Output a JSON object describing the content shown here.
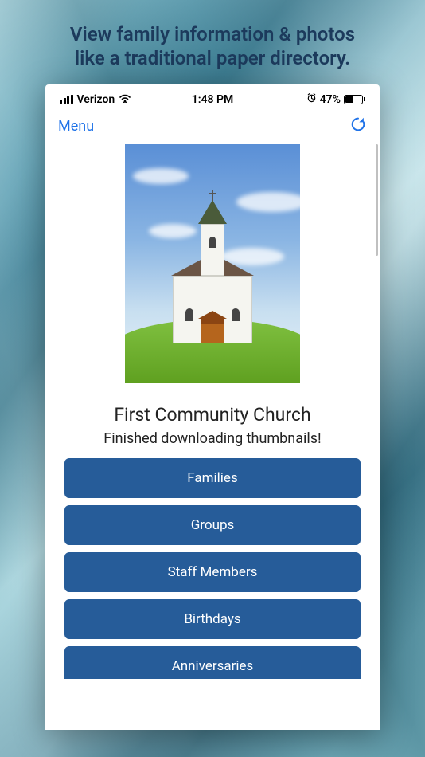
{
  "promo": {
    "line1": "View family information & photos",
    "line2": "like a traditional paper directory."
  },
  "statusBar": {
    "carrier": "Verizon",
    "time": "1:48 PM",
    "batteryPercent": "47%"
  },
  "navBar": {
    "menuLabel": "Menu"
  },
  "main": {
    "title": "First Community Church",
    "statusMessage": "Finished downloading thumbnails!",
    "buttons": [
      {
        "label": "Families"
      },
      {
        "label": "Groups"
      },
      {
        "label": "Staff Members"
      },
      {
        "label": "Birthdays"
      },
      {
        "label": "Anniversaries"
      }
    ]
  },
  "icons": {
    "signal": "signal-icon",
    "wifi": "wifi-icon",
    "alarm": "alarm-icon",
    "battery": "battery-icon",
    "refresh": "refresh-icon"
  },
  "colors": {
    "accent": "#2073e8",
    "buttonBg": "#265c99",
    "promoText": "#1c3a5c"
  }
}
